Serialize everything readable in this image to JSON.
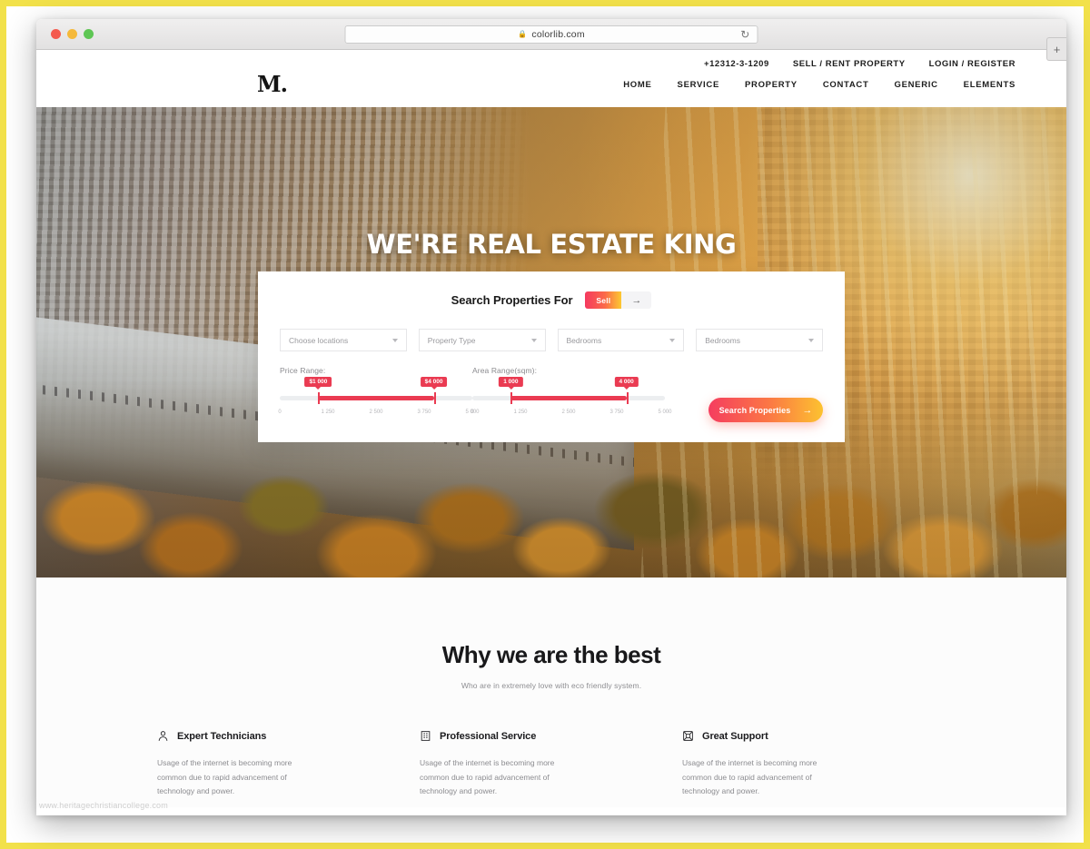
{
  "browser": {
    "url": "colorlib.com",
    "lock_icon": "lock-icon",
    "reload_icon": "reload-icon",
    "new_tab_icon": "plus-icon"
  },
  "header": {
    "logo": "M.",
    "topbar": [
      {
        "label": "+12312-3-1209"
      },
      {
        "label": "SELL / RENT PROPERTY"
      },
      {
        "label": "LOGIN / REGISTER"
      }
    ],
    "nav": [
      {
        "label": "HOME"
      },
      {
        "label": "SERVICE"
      },
      {
        "label": "PROPERTY"
      },
      {
        "label": "CONTACT"
      },
      {
        "label": "GENERIC"
      },
      {
        "label": "ELEMENTS"
      }
    ]
  },
  "hero": {
    "title": "WE'RE REAL ESTATE KING"
  },
  "search_panel": {
    "title": "Search Properties For",
    "toggle": {
      "active_label": "Sell",
      "arrow_icon": "arrow-right-icon"
    },
    "selects": [
      {
        "value": "Choose locations"
      },
      {
        "value": "Property Type"
      },
      {
        "value": "Bedrooms"
      },
      {
        "value": "Bedrooms"
      }
    ],
    "price_range": {
      "label": "Price Range:",
      "min_bubble": "$1 000",
      "max_bubble": "$4 000",
      "min": 0,
      "max": 5000,
      "value_min": 1000,
      "value_max": 4000,
      "ticks": [
        "0",
        "1 250",
        "2 500",
        "3 750",
        "5 000"
      ]
    },
    "area_range": {
      "label": "Area Range(sqm):",
      "min_bubble": "1 000",
      "max_bubble": "4 000",
      "min": 0,
      "max": 5000,
      "value_min": 1000,
      "value_max": 4000,
      "ticks": [
        "0",
        "1 250",
        "2 500",
        "3 750",
        "5 000"
      ]
    },
    "submit": {
      "label": "Search Properties",
      "arrow": "→"
    }
  },
  "best_section": {
    "title": "Why we are the best",
    "subtitle": "Who are in extremely love with eco friendly system.",
    "features": [
      {
        "icon": "user-icon",
        "title": "Expert Technicians",
        "text": "Usage of the internet is becoming more common due to rapid advancement of technology and power."
      },
      {
        "icon": "building-icon",
        "title": "Professional Service",
        "text": "Usage of the internet is becoming more common due to rapid advancement of technology and power."
      },
      {
        "icon": "support-icon",
        "title": "Great Support",
        "text": "Usage of the internet is becoming more common due to rapid advancement of technology and power."
      }
    ]
  },
  "watermark": "www.heritagechristiancollege.com",
  "colors": {
    "accent_pink": "#f5395f",
    "accent_orange": "#fb7645",
    "accent_yellow": "#fcc230",
    "slider_red": "#ea3b52",
    "frame_yellow": "#f2e14a"
  }
}
